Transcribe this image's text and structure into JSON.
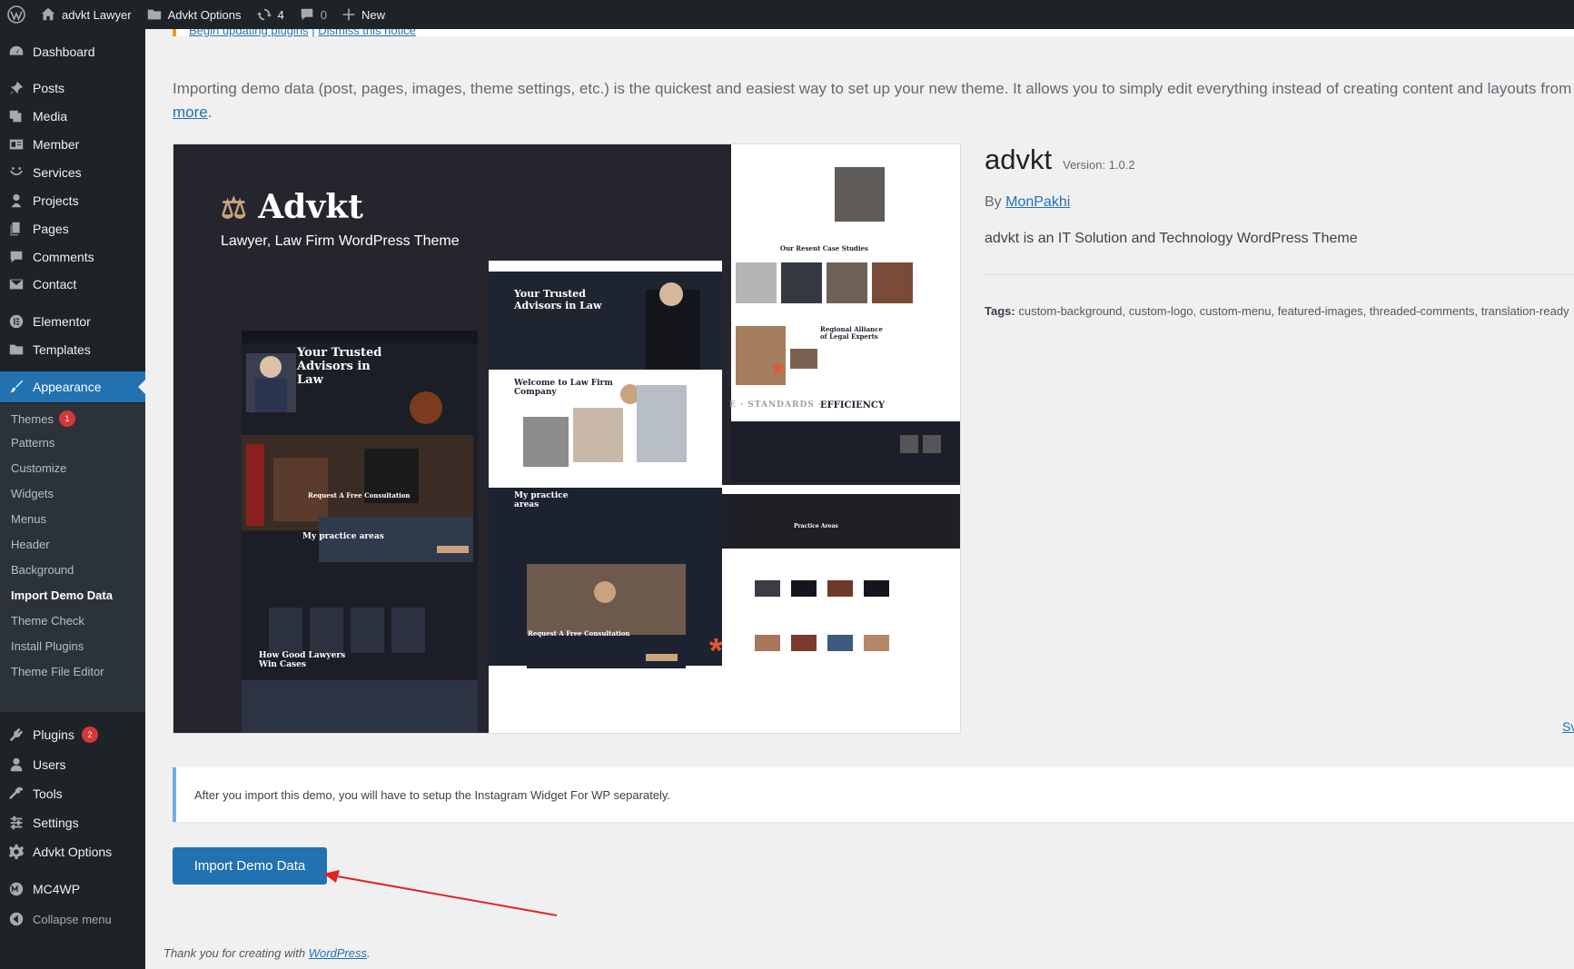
{
  "adminbar": {
    "site_name": "advkt Lawyer",
    "options_label": "Advkt Options",
    "updates_count": "4",
    "comments_count": "0",
    "new_label": "New"
  },
  "sidebar": {
    "items": [
      {
        "label": "Dashboard",
        "icon": "dashboard-icon"
      },
      {
        "label": "Posts",
        "icon": "pin-icon"
      },
      {
        "label": "Media",
        "icon": "media-icon"
      },
      {
        "label": "Member",
        "icon": "id-card-icon"
      },
      {
        "label": "Services",
        "icon": "smile-icon"
      },
      {
        "label": "Projects",
        "icon": "portfolio-icon"
      },
      {
        "label": "Pages",
        "icon": "pages-icon"
      },
      {
        "label": "Comments",
        "icon": "comment-icon"
      },
      {
        "label": "Contact",
        "icon": "email-icon"
      },
      {
        "label": "Elementor",
        "icon": "elementor-icon"
      },
      {
        "label": "Templates",
        "icon": "folder-icon"
      },
      {
        "label": "Appearance",
        "icon": "brush-icon"
      },
      {
        "label": "Plugins",
        "icon": "plugin-icon",
        "badge": "2"
      },
      {
        "label": "Users",
        "icon": "user-icon"
      },
      {
        "label": "Tools",
        "icon": "wrench-icon"
      },
      {
        "label": "Settings",
        "icon": "settings-icon"
      },
      {
        "label": "Advkt Options",
        "icon": "gear-icon"
      },
      {
        "label": "MC4WP",
        "icon": "mc4wp-icon"
      },
      {
        "label": "Collapse menu",
        "icon": "collapse-icon"
      }
    ],
    "appearance_sub": [
      {
        "label": "Themes",
        "badge": "1"
      },
      {
        "label": "Patterns"
      },
      {
        "label": "Customize"
      },
      {
        "label": "Widgets"
      },
      {
        "label": "Menus"
      },
      {
        "label": "Header"
      },
      {
        "label": "Background"
      },
      {
        "label": "Import Demo Data"
      },
      {
        "label": "Theme Check"
      },
      {
        "label": "Install Plugins"
      },
      {
        "label": "Theme File Editor"
      }
    ]
  },
  "notice": {
    "link1": "Begin updating plugins",
    "separator": "|",
    "link2": "Dismiss this notice"
  },
  "intro": {
    "text": "Importing demo data (post, pages, images, theme settings, etc.) is the quickest and easiest way to set up your new theme. It allows you to simply edit everything instead of creating content and layouts from",
    "more": "more",
    "after": "."
  },
  "preview": {
    "brand": "Advkt",
    "tagline": "Lawyer, Law Firm WordPress Theme",
    "hero_line": "Your Trusted Advisors in Law",
    "hero_line_b": "Your Trusted Advisors in Law",
    "welcome": "Welcome to Law Firm Company",
    "consult": "Request A Free Consultation",
    "consult_b": "Request A Free Consultation",
    "practice": "My practice areas",
    "practice_b": "My practice areas",
    "practice_c": "Practice Areas",
    "how_good": "How Good Lawyers Win Cases",
    "case_studies": "Our Resent Case Studies",
    "regional": "Regional Alliance of Legal Experts",
    "efficiency": "EFFICIENCY",
    "standards": "E · STANDARDS ·"
  },
  "theme": {
    "name": "advkt",
    "version": "Version: 1.0.2",
    "by": "By",
    "author": "MonPakhi",
    "description": "advkt is an IT Solution and Technology WordPress Theme",
    "tags_label": "Tags:",
    "tags": "custom-background, custom-logo, custom-menu, featured-images, threaded-comments, translation-ready",
    "screenshot_link": "Sv"
  },
  "info_notice": "After you import this demo, you will have to setup the Instagram Widget For WP separately.",
  "import_button": "Import Demo Data",
  "footer": {
    "text": "Thank you for creating with",
    "link": "WordPress",
    "after": "."
  },
  "colors": {
    "accent": "#2271b1",
    "sidebar_bg": "#1d2327",
    "badge": "#d63638",
    "arrow": "#e02424",
    "preview_accent": "#c9a27e",
    "preview_orange": "#e4572e"
  }
}
